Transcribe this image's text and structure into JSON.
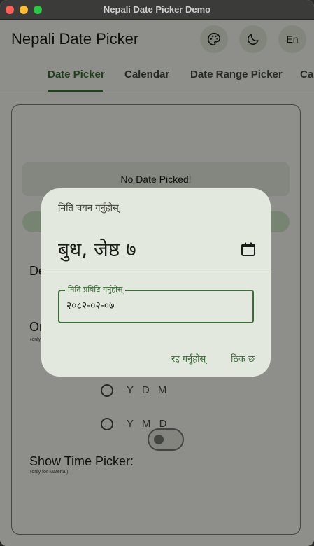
{
  "window": {
    "title": "Nepali Date Picker Demo"
  },
  "appbar": {
    "title": "Nepali Date Picker",
    "lang_label": "En"
  },
  "tabs": [
    "Date Picker",
    "Calendar",
    "Date Range Picker",
    "Ca"
  ],
  "content": {
    "no_date_label": "No Date Picked!",
    "label_de": "De",
    "label_or": "Or",
    "label_only": "(only",
    "radio_ydm": "Y D M",
    "radio_ymd": "Y M D",
    "time_picker_label": "Show Time Picker:",
    "time_picker_note": "(only for Material)"
  },
  "dialog": {
    "header": "मिति चयन गर्नुहोस्",
    "selected_date": "बुध, जेष्ठ ७",
    "field_label": "मिति प्रविष्टि गर्नुहोस्",
    "field_value": "२०८२-०२-०७",
    "cancel_label": "रद्द गर्नुहोस्",
    "ok_label": "ठिक छ"
  },
  "colors": {
    "accent": "#3a6b35",
    "scrim": "rgba(0,0,0,0.42)"
  }
}
